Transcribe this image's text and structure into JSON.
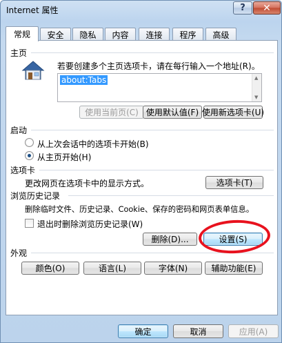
{
  "window": {
    "title": "Internet 属性",
    "help_glyph": "?",
    "close_glyph": "✕"
  },
  "tabs": [
    {
      "label": "常规",
      "active": true
    },
    {
      "label": "安全"
    },
    {
      "label": "隐私"
    },
    {
      "label": "内容"
    },
    {
      "label": "连接"
    },
    {
      "label": "程序"
    },
    {
      "label": "高级"
    }
  ],
  "homepage": {
    "section_title": "主页",
    "instruction": "若要创建多个主页选项卡，请在每行输入一个地址(R)。",
    "value": "about:Tabs",
    "icon": "home-icon",
    "btn_use_current": "使用当前页(C)",
    "btn_use_default": "使用默认值(F)",
    "btn_use_new_tab": "使用新选项卡(U)"
  },
  "startup": {
    "section_title": "启动",
    "option_last_session": "从上次会话中的选项卡开始(B)",
    "option_homepage": "从主页开始(H)",
    "selected": "homepage"
  },
  "tabs_section": {
    "section_title": "选项卡",
    "description": "更改网页在选项卡中的显示方式。",
    "btn_tabs": "选项卡(T)"
  },
  "browsing_history": {
    "section_title": "浏览历史记录",
    "description": "删除临时文件、历史记录、Cookie、保存的密码和网页表单信息。",
    "checkbox_label": "退出时删除浏览历史记录(W)",
    "checkbox_checked": false,
    "btn_delete": "删除(D)...",
    "btn_settings": "设置(S)"
  },
  "appearance": {
    "section_title": "外观",
    "btn_colors": "颜色(O)",
    "btn_languages": "语言(L)",
    "btn_fonts": "字体(N)",
    "btn_accessibility": "辅助功能(E)"
  },
  "footer": {
    "btn_ok": "确定",
    "btn_cancel": "取消",
    "btn_apply": "应用(A)"
  },
  "annotation": {
    "color": "#e8121e",
    "target": "btn_settings"
  }
}
